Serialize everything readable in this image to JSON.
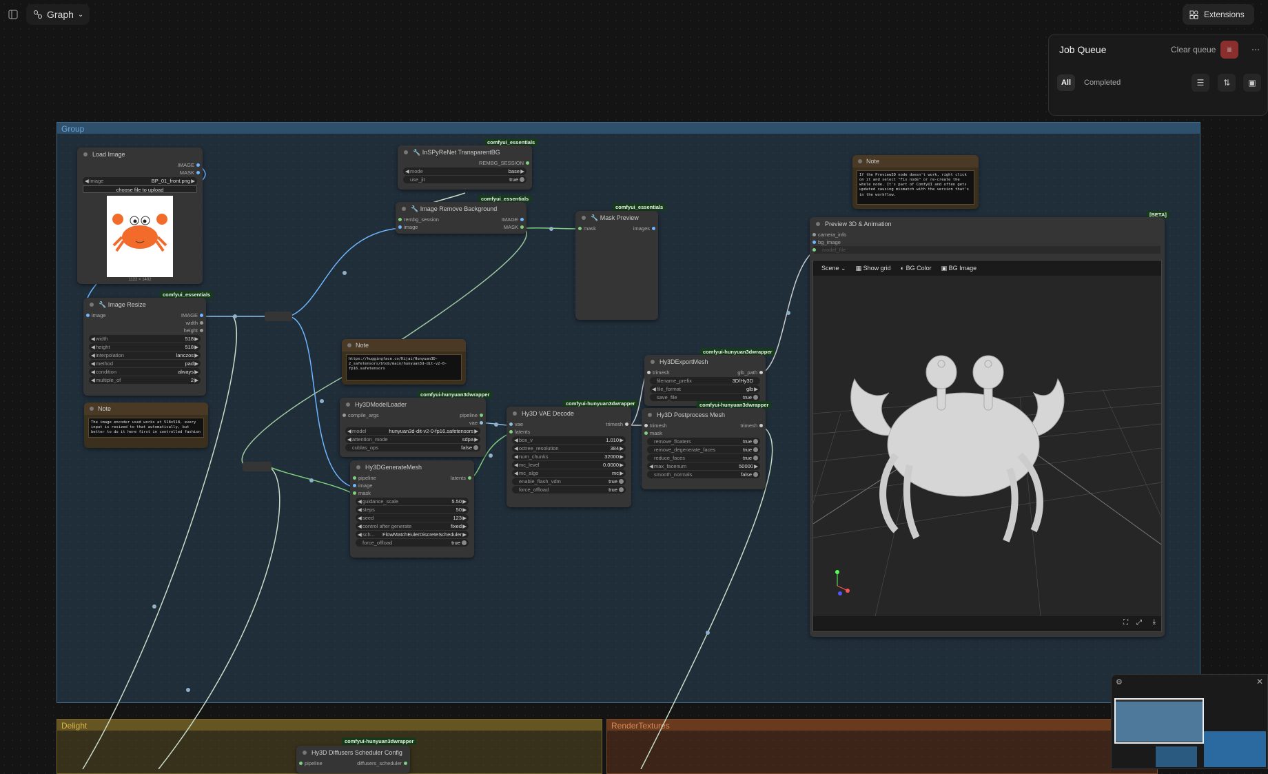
{
  "topbar": {
    "graph_label": "Graph",
    "extensions_label": "Extensions"
  },
  "job_queue": {
    "title": "Job Queue",
    "clear_label": "Clear queue",
    "tab_all": "All",
    "tab_completed": "Completed"
  },
  "groups": {
    "main": "Group",
    "delight": "Delight",
    "render": "RenderTextures"
  },
  "load_image": {
    "title": "Load Image",
    "out1": "IMAGE",
    "out2": "MASK",
    "image_label": "image",
    "image_value": "BP_01_front.png",
    "upload": "choose file to upload",
    "dims": "1122 × 1402"
  },
  "inspy": {
    "badge": "comfyui_essentials",
    "title": "InSPyReNet TransparentBG",
    "out": "REMBG_SESSION",
    "mode_label": "mode",
    "mode_value": "base",
    "jit_label": "use_jit",
    "jit_value": "true"
  },
  "remove_bg": {
    "badge": "comfyui_essentials",
    "title": "Image Remove Background",
    "in1": "rembg_session",
    "in2": "image",
    "out1": "IMAGE",
    "out2": "MASK"
  },
  "mask_preview": {
    "badge": "comfyui_essentials",
    "title": "Mask Preview",
    "in": "mask",
    "out": "images"
  },
  "resize": {
    "badge": "comfyui_essentials",
    "title": "Image Resize",
    "in": "image",
    "out1": "IMAGE",
    "out2": "width",
    "out3": "height",
    "widgets": [
      {
        "k": "width",
        "v": "518"
      },
      {
        "k": "height",
        "v": "518"
      },
      {
        "k": "interpolation",
        "v": "lanczos"
      },
      {
        "k": "method",
        "v": "pad"
      },
      {
        "k": "condition",
        "v": "always"
      },
      {
        "k": "multiple_of",
        "v": "2"
      }
    ]
  },
  "note1": {
    "title": "Note",
    "text": "The image encoder used works at 518x518, every input is resized to that automatically, but better to do it here first in controlled fashion"
  },
  "note2": {
    "title": "Note",
    "text": "https://huggingface.co/Kijai/Hunyuan3D-2_safetensors/blob/main/hunyuan3d-dit-v2-0-fp16.safetensors"
  },
  "note3": {
    "title": "Note",
    "text": "If the Preview3D node doesn't work, right click on it and select \"Fix node\" or re-create the whole node. It's part of ComfyUI and often gets updated causing mismatch with the version that's in the workflow."
  },
  "model_loader": {
    "badge": "comfyui-hunyuan3dwrapper",
    "title": "Hy3DModelLoader",
    "in": "compile_args",
    "out1": "pipeline",
    "out2": "vae",
    "widgets": [
      {
        "k": "model",
        "v": "hunyuan3d-dit-v2-0-fp16.safetensors"
      },
      {
        "k": "attention_mode",
        "v": "sdpa"
      },
      {
        "k": "cublas_ops",
        "v": "false"
      }
    ]
  },
  "gen_mesh": {
    "title": "Hy3DGenerateMesh",
    "in1": "pipeline",
    "in2": "image",
    "in3": "mask",
    "out": "latents",
    "widgets": [
      {
        "k": "guidance_scale",
        "v": "5.50"
      },
      {
        "k": "steps",
        "v": "50"
      },
      {
        "k": "seed",
        "v": "123"
      },
      {
        "k": "control after generate",
        "v": "fixed"
      },
      {
        "k": "sch...",
        "v": "FlowMatchEulerDiscreteScheduler"
      },
      {
        "k": "force_offload",
        "v": "true"
      }
    ]
  },
  "vae_decode": {
    "badge": "comfyui-hunyuan3dwrapper",
    "title": "Hy3D VAE Decode",
    "in1": "vae",
    "in2": "latents",
    "out": "trimesh",
    "widgets": [
      {
        "k": "box_v",
        "v": "1.010"
      },
      {
        "k": "octree_resolution",
        "v": "384"
      },
      {
        "k": "num_chunks",
        "v": "32000"
      },
      {
        "k": "mc_level",
        "v": "0.0000"
      },
      {
        "k": "mc_algo",
        "v": "mc"
      },
      {
        "k": "enable_flash_vdm",
        "v": "true"
      },
      {
        "k": "force_offload",
        "v": "true"
      }
    ]
  },
  "export_mesh": {
    "badge": "comfyui-hunyuan3dwrapper",
    "title": "Hy3DExportMesh",
    "in": "trimesh",
    "out": "glb_path",
    "widgets": [
      {
        "k": "filename_prefix",
        "v": "3D/Hy3D"
      },
      {
        "k": "file_format",
        "v": "glb"
      },
      {
        "k": "save_file",
        "v": "true"
      }
    ]
  },
  "postprocess": {
    "badge": "comfyui-hunyuan3dwrapper",
    "title": "Hy3D Postprocess Mesh",
    "in1": "trimesh",
    "in2": "mask",
    "out": "trimesh",
    "widgets": [
      {
        "k": "remove_floaters",
        "v": "true"
      },
      {
        "k": "remove_degenerate_faces",
        "v": "true"
      },
      {
        "k": "reduce_faces",
        "v": "true"
      },
      {
        "k": "max_facenum",
        "v": "50000"
      },
      {
        "k": "smooth_normals",
        "v": "false"
      }
    ]
  },
  "preview3d": {
    "badge": "[BETA]",
    "title": "Preview 3D & Animation",
    "in1": "camera_info",
    "in2": "bg_image",
    "in3": "model_file",
    "scene": "Scene",
    "show_grid": "Show grid",
    "bg_color": "BG Color",
    "bg_image": "BG Image"
  },
  "scheduler": {
    "badge": "comfyui-hunyuan3dwrapper",
    "title": "Hy3D Diffusers Scheduler Config",
    "in": "pipeline",
    "out": "diffusers_scheduler"
  }
}
